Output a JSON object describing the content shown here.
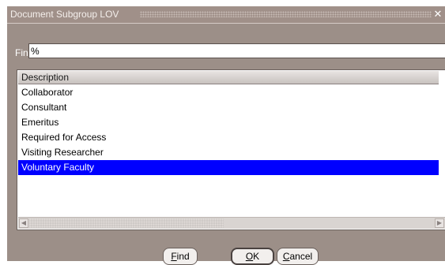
{
  "window": {
    "title": "Document Subgroup LOV",
    "close_glyph": "✕"
  },
  "find": {
    "label": "Find",
    "value": "%"
  },
  "list": {
    "column_header": "Description",
    "rows": [
      "Collaborator",
      "Consultant",
      "Emeritus",
      "Required for Access",
      "Visiting Researcher",
      "Voluntary Faculty"
    ],
    "selected_index": 5
  },
  "buttons": {
    "find": {
      "mnemonic": "F",
      "rest": "ind"
    },
    "ok": {
      "mnemonic": "O",
      "rest": "K"
    },
    "cancel": {
      "mnemonic": "C",
      "rest": "ancel"
    }
  },
  "colors": {
    "selection": "#0000ff",
    "window_bg": "#9c8f88"
  }
}
